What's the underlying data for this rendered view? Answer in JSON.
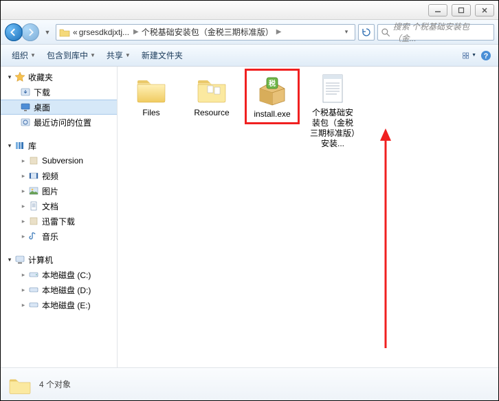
{
  "titlebar": {
    "min": "—",
    "max": "▣",
    "close": "✕"
  },
  "address": {
    "seg1": "grsesdkdjxtj...",
    "seg2": "个税基础安装包（金税三期标准版）",
    "prefix": "«"
  },
  "search": {
    "placeholder": "搜索 个税基础安装包（金..."
  },
  "toolbar": {
    "organize": "组织",
    "include": "包含到库中",
    "share": "共享",
    "newfolder": "新建文件夹"
  },
  "sidebar": {
    "favorites": "收藏夹",
    "downloads": "下载",
    "desktop": "桌面",
    "recent": "最近访问的位置",
    "library": "库",
    "subversion": "Subversion",
    "video": "视频",
    "pictures": "图片",
    "docs": "文档",
    "xunlei": "迅雷下载",
    "music": "音乐",
    "computer": "计算机",
    "diskC": "本地磁盘 (C:)",
    "diskD": "本地磁盘 (D:)",
    "diskE": "本地磁盘 (E:)"
  },
  "files": {
    "f1": "Files",
    "f2": "Resource",
    "f3": "install.exe",
    "f4": "个税基础安装包（金税三期标准版）安装..."
  },
  "status": {
    "count": "4 个对象"
  }
}
